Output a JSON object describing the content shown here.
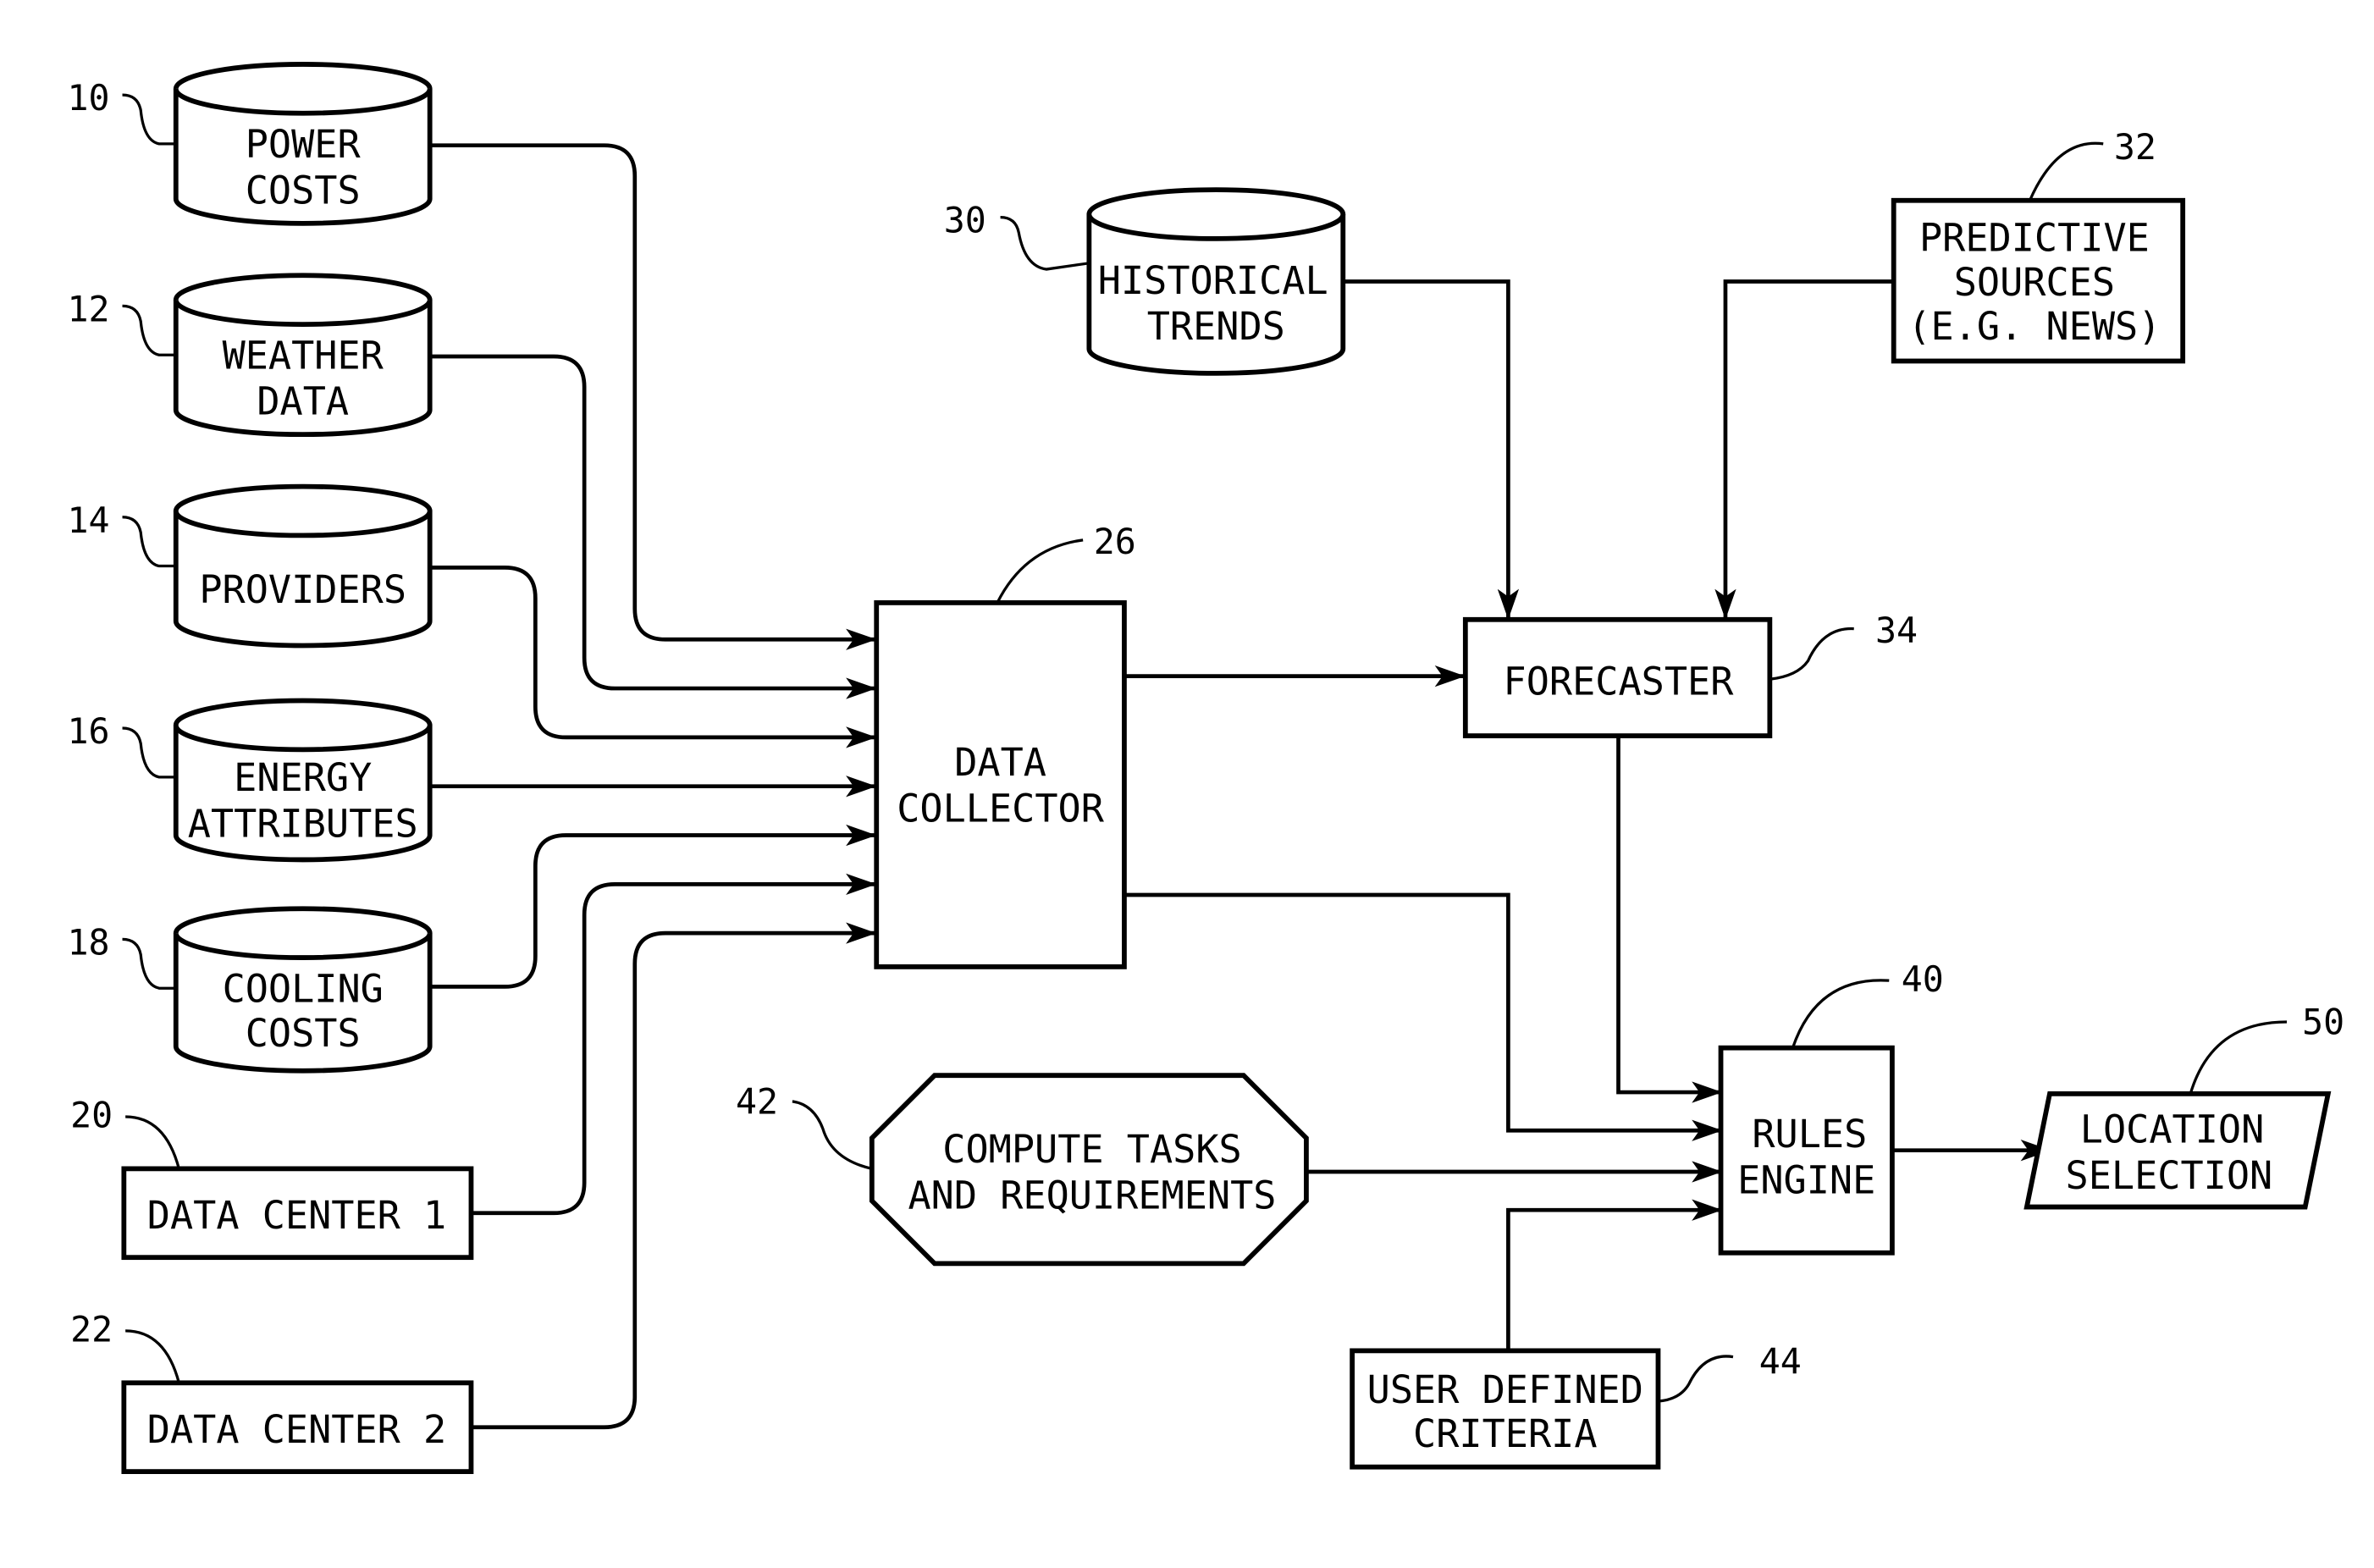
{
  "diagram": {
    "type": "flow-block-diagram",
    "line_color": "#000000",
    "background": "#ffffff",
    "nodes": {
      "power_costs": {
        "ref": "10",
        "shape": "database",
        "lines": [
          "POWER",
          "COSTS"
        ]
      },
      "weather_data": {
        "ref": "12",
        "shape": "database",
        "lines": [
          "WEATHER",
          "DATA"
        ]
      },
      "providers": {
        "ref": "14",
        "shape": "database",
        "lines": [
          "PROVIDERS"
        ]
      },
      "energy_attributes": {
        "ref": "16",
        "shape": "database",
        "lines": [
          "ENERGY",
          "ATTRIBUTES"
        ]
      },
      "cooling_costs": {
        "ref": "18",
        "shape": "database",
        "lines": [
          "COOLING",
          "COSTS"
        ]
      },
      "data_center_1": {
        "ref": "20",
        "shape": "box",
        "lines": [
          "DATA CENTER 1"
        ]
      },
      "data_center_2": {
        "ref": "22",
        "shape": "box",
        "lines": [
          "DATA CENTER 2"
        ]
      },
      "data_collector": {
        "ref": "26",
        "shape": "box",
        "lines": [
          "DATA",
          "COLLECTOR"
        ]
      },
      "historical_trends": {
        "ref": "30",
        "shape": "database",
        "lines": [
          "HISTORICAL",
          "TRENDS"
        ]
      },
      "predictive_sources": {
        "ref": "32",
        "shape": "box",
        "lines": [
          "PREDICTIVE",
          "SOURCES",
          "(E.G. NEWS)"
        ]
      },
      "forecaster": {
        "ref": "34",
        "shape": "box",
        "lines": [
          "FORECASTER"
        ]
      },
      "rules_engine": {
        "ref": "40",
        "shape": "box",
        "lines": [
          "RULES",
          "ENGINE"
        ]
      },
      "compute_tasks": {
        "ref": "42",
        "shape": "octagon",
        "lines": [
          "COMPUTE TASKS",
          "AND REQUIREMENTS"
        ]
      },
      "user_criteria": {
        "ref": "44",
        "shape": "box",
        "lines": [
          "USER DEFINED",
          "CRITERIA"
        ]
      },
      "location_selection": {
        "ref": "50",
        "shape": "parallelogram",
        "lines": [
          "LOCATION",
          "SELECTION"
        ]
      }
    },
    "edges": [
      {
        "from": "power_costs",
        "to": "data_collector"
      },
      {
        "from": "weather_data",
        "to": "data_collector"
      },
      {
        "from": "providers",
        "to": "data_collector"
      },
      {
        "from": "energy_attributes",
        "to": "data_collector"
      },
      {
        "from": "cooling_costs",
        "to": "data_collector"
      },
      {
        "from": "data_center_1",
        "to": "data_collector"
      },
      {
        "from": "data_center_2",
        "to": "data_collector"
      },
      {
        "from": "data_collector",
        "to": "forecaster"
      },
      {
        "from": "historical_trends",
        "to": "forecaster"
      },
      {
        "from": "predictive_sources",
        "to": "forecaster"
      },
      {
        "from": "forecaster",
        "to": "rules_engine"
      },
      {
        "from": "data_collector",
        "to": "rules_engine"
      },
      {
        "from": "compute_tasks",
        "to": "rules_engine"
      },
      {
        "from": "user_criteria",
        "to": "rules_engine"
      },
      {
        "from": "rules_engine",
        "to": "location_selection"
      }
    ]
  }
}
